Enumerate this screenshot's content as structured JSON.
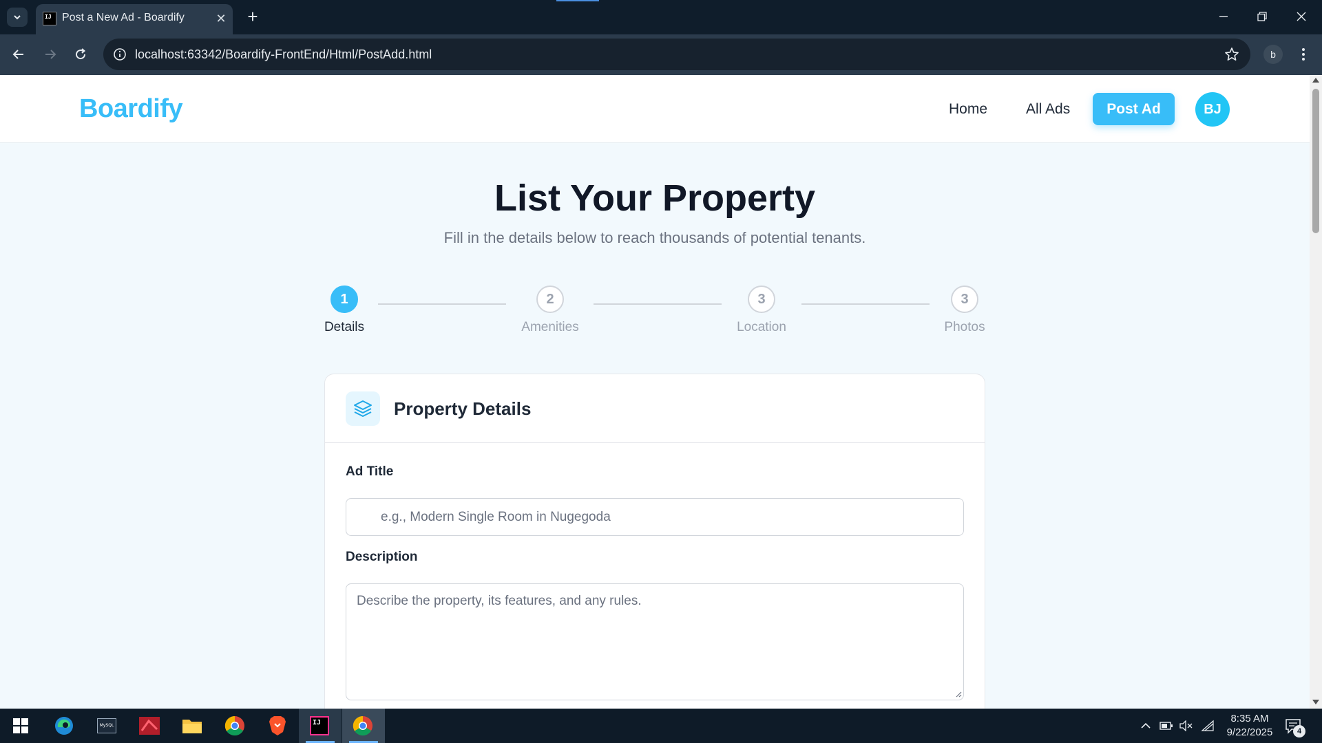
{
  "browser": {
    "tab_title": "Post a New Ad - Boardify",
    "tab_favicon_text": "IJ",
    "url": "localhost:63342/Boardify-FrontEnd/Html/PostAdd.html",
    "profile_initial": "b"
  },
  "header": {
    "logo": "Boardify",
    "nav": {
      "home": "Home",
      "all_ads": "All Ads",
      "post_ad": "Post Ad"
    },
    "avatar_initials": "BJ"
  },
  "hero": {
    "title": "List Your Property",
    "subtitle": "Fill in the details below to reach thousands of potential tenants."
  },
  "steps": [
    {
      "number": "1",
      "label": "Details",
      "active": true
    },
    {
      "number": "2",
      "label": "Amenities",
      "active": false
    },
    {
      "number": "3",
      "label": "Location",
      "active": false
    },
    {
      "number": "3",
      "label": "Photos",
      "active": false
    }
  ],
  "form": {
    "section_title": "Property Details",
    "ad_title": {
      "label": "Ad Title",
      "placeholder": "e.g., Modern Single Room in Nugegoda",
      "value": ""
    },
    "description": {
      "label": "Description",
      "placeholder": "Describe the property, its features, and any rules.",
      "value": ""
    }
  },
  "taskbar": {
    "time": "8:35 AM",
    "date": "9/22/2025",
    "notification_count": "4",
    "mysql_label": "MySQL"
  },
  "colors": {
    "accent": "#38bdf8",
    "title": "#111827",
    "page_bg": "#f2f9fd",
    "browser_dark": "#0f1d2b"
  }
}
